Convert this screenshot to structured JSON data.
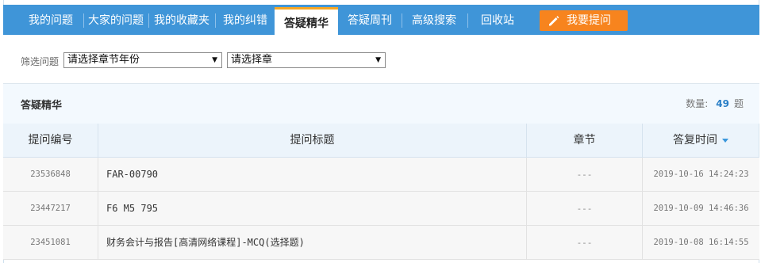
{
  "nav": {
    "tabs": [
      {
        "label": "我的问题"
      },
      {
        "label": "大家的问题"
      },
      {
        "label": "我的收藏夹"
      },
      {
        "label": "我的纠错"
      },
      {
        "label": "答疑精华"
      },
      {
        "label": "答疑周刊"
      },
      {
        "label": "高级搜索"
      },
      {
        "label": "回收站"
      }
    ],
    "active_tab": "答疑精华",
    "ask_button": {
      "label": "我要提问",
      "icon": "pencil-icon"
    }
  },
  "filter": {
    "label": "筛选问题",
    "select_year": "请选择章节年份",
    "select_chapter": "请选择章"
  },
  "section": {
    "title": "答疑精华",
    "count_label": "数量:",
    "count_value": "49",
    "count_unit": "题"
  },
  "table": {
    "columns": [
      "提问编号",
      "提问标题",
      "章节",
      "答复时间"
    ],
    "sort_column": "答复时间",
    "rows": [
      {
        "id": "23536848",
        "title": "FAR-00790",
        "chapter": "---",
        "time": "2019-10-16 14:24:23"
      },
      {
        "id": "23447217",
        "title": "F6 M5 795",
        "chapter": "---",
        "time": "2019-10-09 14:46:36"
      },
      {
        "id": "23451081",
        "title": "财务会计与报告[高清网络课程]-MCQ(选择题)",
        "chapter": "---",
        "time": "2019-10-08 16:14:55"
      }
    ]
  },
  "colors": {
    "nav_bg": "#3f95d8",
    "active_tab_accent": "#f5a623",
    "ask_button_bg": "#f7841e",
    "count_value": "#2a7fc7"
  }
}
